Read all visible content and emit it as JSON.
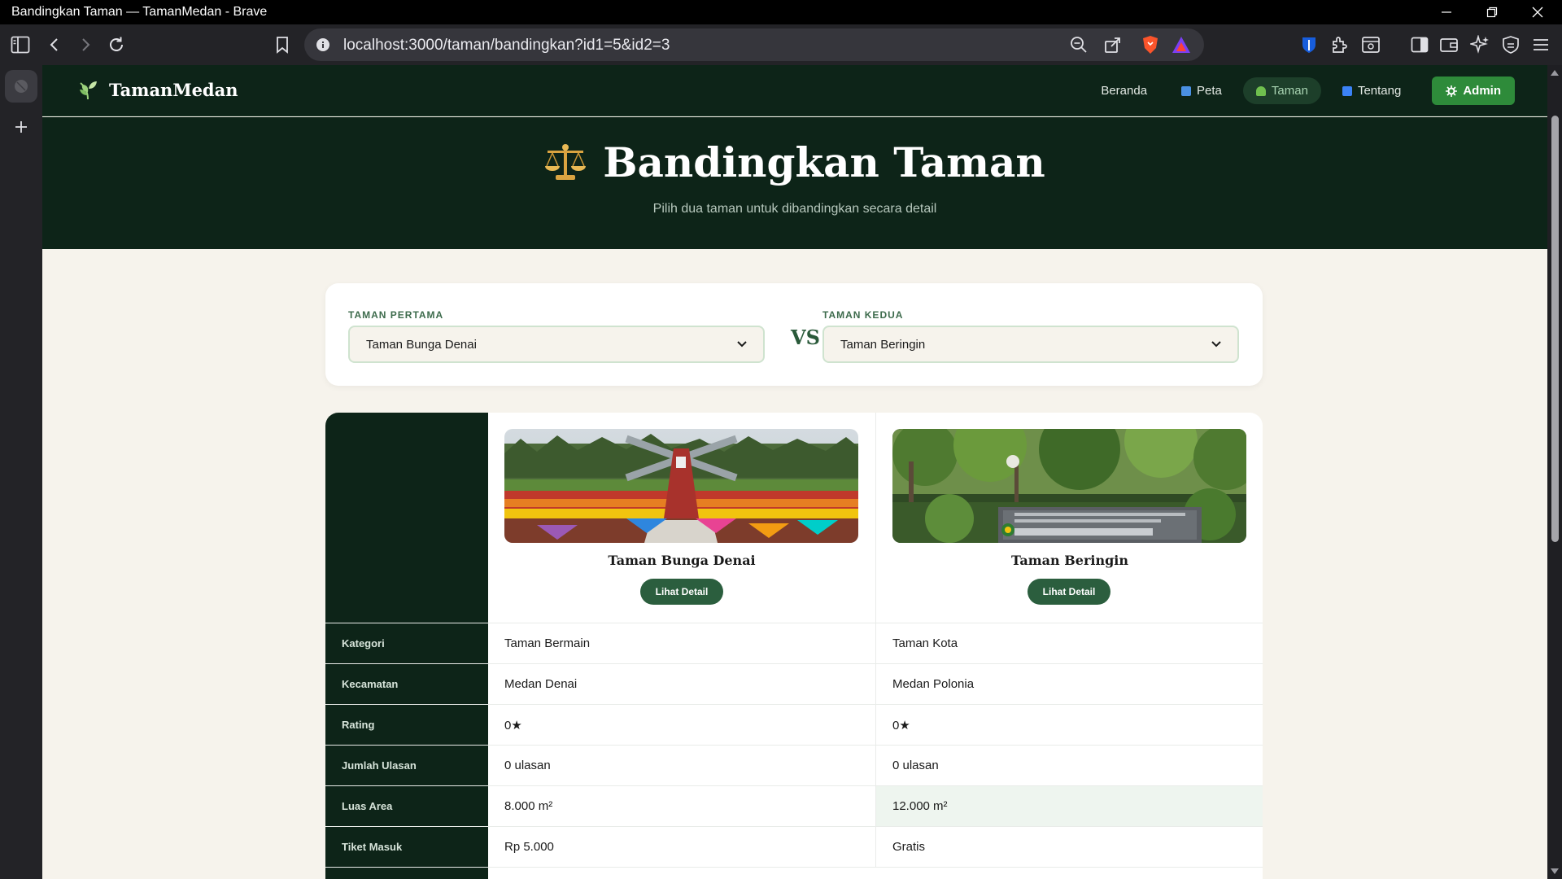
{
  "window": {
    "title": "Bandingkan Taman — TamanMedan - Brave"
  },
  "browser": {
    "url": "localhost:3000/taman/bandingkan?id1=5&id2=3"
  },
  "site": {
    "brand": "TamanMedan",
    "nav": {
      "beranda": "Beranda",
      "peta": "Peta",
      "taman": "Taman",
      "tentang": "Tentang",
      "admin": "Admin"
    }
  },
  "hero": {
    "title": "Bandingkan Taman",
    "subtitle": "Pilih dua taman untuk dibandingkan secara detail"
  },
  "selector": {
    "first_label": "TAMAN PERTAMA",
    "first_value": "Taman Bunga Denai",
    "vs": "VS",
    "second_label": "TAMAN KEDUA",
    "second_value": "Taman Beringin"
  },
  "compare": {
    "park_a": {
      "name": "Taman Bunga Denai",
      "button": "Lihat Detail"
    },
    "park_b": {
      "name": "Taman Beringin",
      "button": "Lihat Detail"
    },
    "rows": [
      {
        "label": "Kategori",
        "a": "Taman Bermain",
        "b": "Taman Kota"
      },
      {
        "label": "Kecamatan",
        "a": "Medan Denai",
        "b": "Medan Polonia"
      },
      {
        "label": "Rating",
        "a": "0★",
        "b": "0★"
      },
      {
        "label": "Jumlah Ulasan",
        "a": "0 ulasan",
        "b": "0 ulasan"
      },
      {
        "label": "Luas Area",
        "a": "8.000 m²",
        "b": "12.000 m²"
      },
      {
        "label": "Tiket Masuk",
        "a": "Rp 5.000",
        "b": "Gratis"
      }
    ]
  },
  "colors": {
    "accent": "#2e8b3a",
    "dark_green": "#0d2418",
    "highlight": "#eef5ef"
  }
}
